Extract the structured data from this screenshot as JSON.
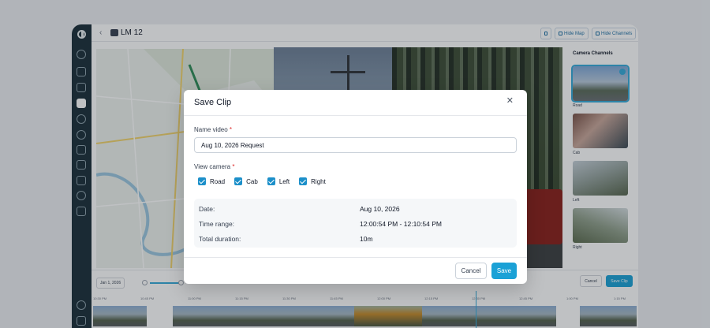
{
  "header": {
    "back_icon": "chevron-left-icon",
    "vehicle_icon": "truck-icon",
    "vehicle_name": "LM 12",
    "hide_map": "Hide Map",
    "hide_channels": "Hide Channels"
  },
  "channels": {
    "title": "Camera Channels",
    "items": [
      {
        "label": "Road",
        "selected": true
      },
      {
        "label": "Cab",
        "selected": false
      },
      {
        "label": "Left",
        "selected": false
      },
      {
        "label": "Right",
        "selected": false
      }
    ]
  },
  "timeline": {
    "date": "Jan 1, 2026",
    "cancel": "Cancel",
    "save_clip": "Save Clip",
    "ticks": [
      "10:30 PM",
      "10:45 PM",
      "11:00 PM",
      "11:15 PM",
      "11:30 PM",
      "11:45 PM",
      "12:00 PM",
      "12:15 PM",
      "12:30 PM",
      "12:45 PM",
      "1:00 PM",
      "1:15 PM"
    ]
  },
  "modal": {
    "title": "Save Clip",
    "name_label": "Name video",
    "name_value": "Aug 10, 2026 Request",
    "camera_label": "View camera",
    "required_mark": "*",
    "cameras": [
      {
        "label": "Road",
        "checked": true
      },
      {
        "label": "Cab",
        "checked": true
      },
      {
        "label": "Left",
        "checked": true
      },
      {
        "label": "Right",
        "checked": true
      }
    ],
    "summary": {
      "date_label": "Date:",
      "date_value": "Aug 10, 2026",
      "range_label": "Time range:",
      "range_value": "12:00:54 PM - 12:10:54 PM",
      "duration_label": "Total duration:",
      "duration_value": "10m"
    },
    "cancel": "Cancel",
    "save": "Save"
  },
  "colors": {
    "accent": "#1ba1d6",
    "nav_bg": "#1b2f3a",
    "required": "#dc2626"
  }
}
